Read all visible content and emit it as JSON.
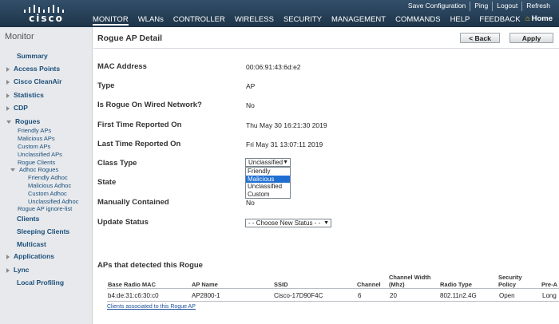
{
  "brand": "cisco",
  "top_links": [
    "Save Configuration",
    "Ping",
    "Logout",
    "Refresh"
  ],
  "nav": [
    {
      "label": "MONITOR",
      "active": true
    },
    {
      "label": "WLANs"
    },
    {
      "label": "CONTROLLER"
    },
    {
      "label": "WIRELESS"
    },
    {
      "label": "SECURITY"
    },
    {
      "label": "MANAGEMENT"
    },
    {
      "label": "COMMANDS"
    },
    {
      "label": "HELP"
    },
    {
      "label": "FEEDBACK"
    }
  ],
  "home_label": "Home",
  "sidebar": {
    "title": "Monitor",
    "items": [
      {
        "label": "Summary",
        "arrow": "none"
      },
      {
        "label": "Access Points",
        "arrow": "right"
      },
      {
        "label": "Cisco CleanAir",
        "arrow": "right"
      },
      {
        "label": "Statistics",
        "arrow": "right"
      },
      {
        "label": "CDP",
        "arrow": "right"
      },
      {
        "label": "Rogues",
        "arrow": "down"
      },
      {
        "label": "Clients",
        "arrow": "none"
      },
      {
        "label": "Sleeping Clients",
        "arrow": "none"
      },
      {
        "label": "Multicast",
        "arrow": "none"
      },
      {
        "label": "Applications",
        "arrow": "right"
      },
      {
        "label": "Lync",
        "arrow": "right"
      },
      {
        "label": "Local Profiling",
        "arrow": "none"
      }
    ],
    "rogue_subitems": [
      "Friendly APs",
      "Malicious APs",
      "Custom APs",
      "Unclassified APs",
      "Rogue Clients"
    ],
    "adhoc_label": "Adhoc Rogues",
    "adhoc_subitems": [
      "Friendly Adhoc",
      "Malicious Adhoc",
      "Custom Adhoc",
      "Unclassified Adhoc"
    ],
    "ignore_list": "Rogue AP ignore-list"
  },
  "page": {
    "title": "Rogue AP Detail",
    "back_label": "< Back",
    "apply_label": "Apply"
  },
  "details": [
    {
      "label": "MAC Address",
      "value": "00:06:91:43:6d:e2"
    },
    {
      "label": "Type",
      "value": "AP"
    },
    {
      "label": "Is Rogue On Wired Network?",
      "value": "No"
    },
    {
      "label": "First Time Reported On",
      "value": "Thu May 30 16:21:30 2019"
    },
    {
      "label": "Last Time Reported On",
      "value": "Fri May 31 13:07:11 2019"
    },
    {
      "label": "Class Type",
      "value": ""
    },
    {
      "label": "State",
      "value": ""
    },
    {
      "label": "Manually Contained",
      "value": "No"
    },
    {
      "label": "Update Status",
      "value": ""
    }
  ],
  "class_type": {
    "selected": "Unclassified",
    "options": [
      "Friendly",
      "Malicious",
      "Unclassified",
      "Custom"
    ],
    "highlighted": "Malicious"
  },
  "update_status": {
    "selected": "- - Choose New Status - -"
  },
  "aps_section": {
    "heading": "APs that detected this Rogue",
    "columns": [
      "Base Radio MAC",
      "AP Name",
      "SSID",
      "Channel",
      "Channel Width (Mhz)",
      "Radio Type",
      "Security Policy",
      "Pre-A"
    ],
    "rows": [
      [
        "b4:de:31:c6:30:c0",
        "AP2800-1",
        "Cisco-17D90F4C",
        "6",
        "20",
        "802.11n2.4G",
        "Open",
        "Long"
      ]
    ],
    "clients_link": "Clients associated to this Rogue AP"
  },
  "colors": {
    "header_bg": "#2b465f",
    "sidebar_bg": "#e7e9ec",
    "link_blue": "#1c4f7a",
    "highlight": "#1f6fd1"
  }
}
